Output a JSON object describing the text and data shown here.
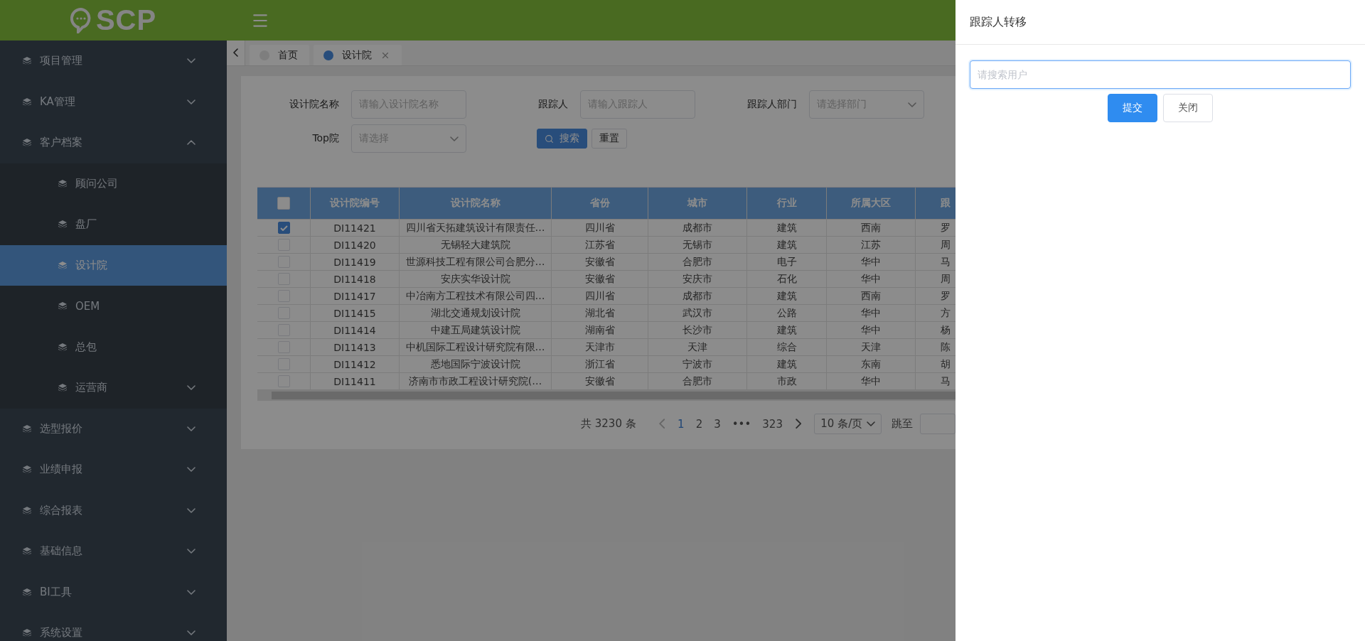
{
  "logo": {
    "text": "SCP"
  },
  "sidebar": {
    "items": [
      {
        "label": "项目管理",
        "expanded": false
      },
      {
        "label": "KA管理",
        "expanded": false
      },
      {
        "label": "客户档案",
        "expanded": true,
        "children": [
          {
            "label": "顾问公司",
            "selected": false
          },
          {
            "label": "盘厂",
            "selected": false
          },
          {
            "label": "设计院",
            "selected": true
          },
          {
            "label": "OEM",
            "selected": false
          },
          {
            "label": "总包",
            "selected": false
          },
          {
            "label": "运营商",
            "selected": false,
            "expanded": false
          }
        ]
      },
      {
        "label": "选型报价",
        "expanded": false
      },
      {
        "label": "业绩申报",
        "expanded": false
      },
      {
        "label": "综合报表",
        "expanded": false
      },
      {
        "label": "基础信息",
        "expanded": false
      },
      {
        "label": "BI工具",
        "expanded": false
      },
      {
        "label": "系统设置",
        "expanded": false
      }
    ]
  },
  "tabs": [
    {
      "label": "首页",
      "selected": false,
      "closable": false
    },
    {
      "label": "设计院",
      "selected": true,
      "closable": true
    }
  ],
  "filters": [
    {
      "label": "设计院名称",
      "placeholder": "请输入设计院名称",
      "kind": "input"
    },
    {
      "label": "跟踪人",
      "placeholder": "请输入跟踪人",
      "kind": "input"
    },
    {
      "label": "跟踪人部门",
      "placeholder": "请选择部门",
      "kind": "select"
    },
    {
      "label": "Top院",
      "placeholder": "请选择",
      "kind": "select"
    }
  ],
  "filter_buttons": [
    {
      "label": "搜索",
      "kind": "primary"
    },
    {
      "label": "重置",
      "kind": "default"
    }
  ],
  "table": {
    "header_checked": false,
    "columns": [
      "设计院编号",
      "设计院名称",
      "省份",
      "城市",
      "行业",
      "所属大区",
      "跟"
    ],
    "rows": [
      {
        "checked": true,
        "cells": [
          "DI11421",
          "四川省天拓建筑设计有限责任…",
          "四川省",
          "成都市",
          "建筑",
          "西南",
          "罗"
        ]
      },
      {
        "checked": false,
        "cells": [
          "DI11420",
          "无锡轻大建筑院",
          "江苏省",
          "无锡市",
          "建筑",
          "江苏",
          "周"
        ]
      },
      {
        "checked": false,
        "cells": [
          "DI11419",
          "世源科技工程有限公司合肥分…",
          "安徽省",
          "合肥市",
          "电子",
          "华中",
          "马"
        ]
      },
      {
        "checked": false,
        "cells": [
          "DI11418",
          "安庆实华设计院",
          "安徽省",
          "安庆市",
          "石化",
          "华中",
          "周"
        ]
      },
      {
        "checked": false,
        "cells": [
          "DI11417",
          "中冶南方工程技术有限公司四…",
          "四川省",
          "成都市",
          "建筑",
          "西南",
          "罗"
        ]
      },
      {
        "checked": false,
        "cells": [
          "DI11415",
          "湖北交通规划设计院",
          "湖北省",
          "武汉市",
          "公路",
          "华中",
          "方"
        ]
      },
      {
        "checked": false,
        "cells": [
          "DI11414",
          "中建五局建筑设计院",
          "湖南省",
          "长沙市",
          "建筑",
          "华中",
          "杨"
        ]
      },
      {
        "checked": false,
        "cells": [
          "DI11413",
          "中机国际工程设计研究院有限…",
          "天津市",
          "天津",
          "综合",
          "天津",
          "陈"
        ]
      },
      {
        "checked": false,
        "cells": [
          "DI11412",
          "悉地国际宁波设计院",
          "浙江省",
          "宁波市",
          "建筑",
          "东南",
          "胡"
        ]
      },
      {
        "checked": false,
        "cells": [
          "DI11411",
          "济南市市政工程设计研究院(…",
          "安徽省",
          "合肥市",
          "市政",
          "华中",
          "马"
        ]
      }
    ]
  },
  "pagination": {
    "total": "共 3230 条",
    "pages": [
      {
        "label": "1",
        "selected": true
      },
      {
        "label": "2",
        "selected": false
      },
      {
        "label": "3",
        "selected": false
      },
      {
        "label": "•••",
        "selected": false
      },
      {
        "label": "323",
        "selected": false
      }
    ],
    "page_size": "10 条/页",
    "jump_label": "跳至"
  },
  "drawer": {
    "title": "跟踪人转移",
    "search": {
      "placeholder": "请搜索用户"
    },
    "buttons": [
      {
        "label": "提交",
        "kind": "primary"
      },
      {
        "label": "关闭",
        "kind": "default"
      }
    ]
  }
}
